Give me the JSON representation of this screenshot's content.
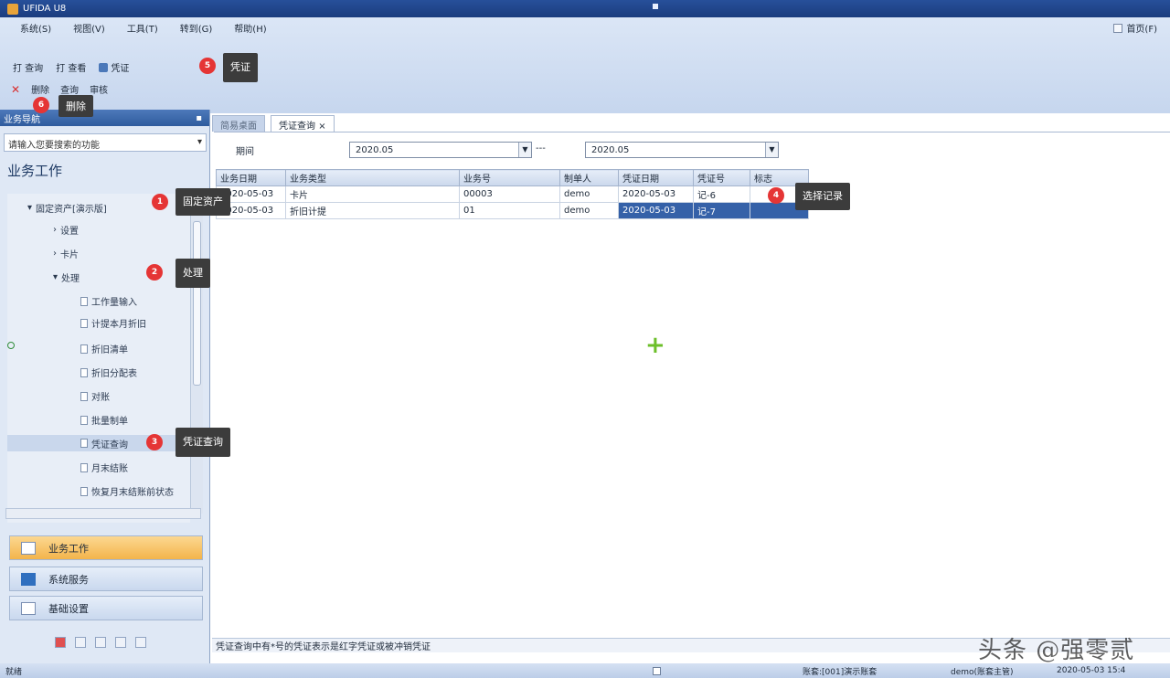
{
  "window": {
    "title": "UFIDA U8"
  },
  "menu": [
    "系统(S)",
    "视图(V)",
    "工具(T)",
    "转到(G)",
    "帮助(H)"
  ],
  "right_button": "首页(F)",
  "toolbar": {
    "items": [
      "打 查询",
      "打 查看",
      "凭证"
    ],
    "row2": [
      "删除",
      "查询",
      "审核"
    ]
  },
  "left_panel": {
    "header": "业务导航",
    "search_placeholder": "请输入您要搜索的功能",
    "section_title": "业务工作",
    "tree": [
      {
        "label": "固定资产[演示版]"
      },
      {
        "label": "设置"
      },
      {
        "label": "卡片"
      },
      {
        "label": "处理"
      },
      {
        "label": "工作量输入"
      },
      {
        "label": "计提本月折旧"
      },
      {
        "label": "折旧清单"
      },
      {
        "label": "折旧分配表"
      },
      {
        "label": "对账"
      },
      {
        "label": "批量制单"
      },
      {
        "label": "凭证查询"
      },
      {
        "label": "月末结账"
      },
      {
        "label": "恢复月末结账前状态"
      }
    ],
    "nav": [
      "业务工作",
      "系统服务",
      "基础设置"
    ]
  },
  "tabs": [
    "简易桌面",
    "凭证查询"
  ],
  "filter": {
    "label": "期间",
    "from": "2020.05",
    "separator": "---",
    "to": "2020.05"
  },
  "grid": {
    "columns": [
      "业务日期",
      "业务类型",
      "业务号",
      "制单人",
      "凭证日期",
      "凭证号",
      "标志"
    ],
    "rows": [
      [
        "2020-05-03",
        "卡片",
        "00003",
        "demo",
        "2020-05-03",
        "记-6",
        ""
      ],
      [
        "2020-05-03",
        "折旧计提",
        "01",
        "demo",
        "2020-05-03",
        "记-7",
        ""
      ]
    ]
  },
  "hint": "凭证查询中有*号的凭证表示是红字凭证或被冲销凭证",
  "status": {
    "ready": "就绪",
    "account": "账套:[001]演示账套",
    "user": "demo(账套主管)",
    "time": "2020-05-03 15:4"
  },
  "annotations": {
    "step1": "固定资产",
    "step2": "处理",
    "step3": "凭证查询",
    "step4": "选择记录",
    "step5": "凭证",
    "step6": "删除"
  },
  "watermark": "头条 @强零贰"
}
